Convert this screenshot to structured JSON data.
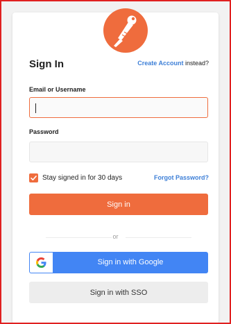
{
  "header": {
    "title": "Sign In",
    "create_account_link": "Create Account",
    "create_account_suffix": " instead?"
  },
  "form": {
    "username_label": "Email or Username",
    "username_value": "",
    "password_label": "Password",
    "password_value": "",
    "stay_signed_in_label": "Stay signed in for 30 days",
    "stay_signed_in_checked": true,
    "forgot_password": "Forgot Password?",
    "sign_in_button": "Sign in"
  },
  "alternate": {
    "or_text": "or",
    "google_button": "Sign in with Google",
    "sso_button": "Sign in with SSO"
  },
  "icons": {
    "logo": "postman-astronaut-logo",
    "google": "google-g-icon",
    "checkbox": "checkmark-icon"
  },
  "colors": {
    "brand": "#ef6c3d",
    "link": "#3d7fd7",
    "google": "#4285f4",
    "sso_bg": "#ededed"
  }
}
